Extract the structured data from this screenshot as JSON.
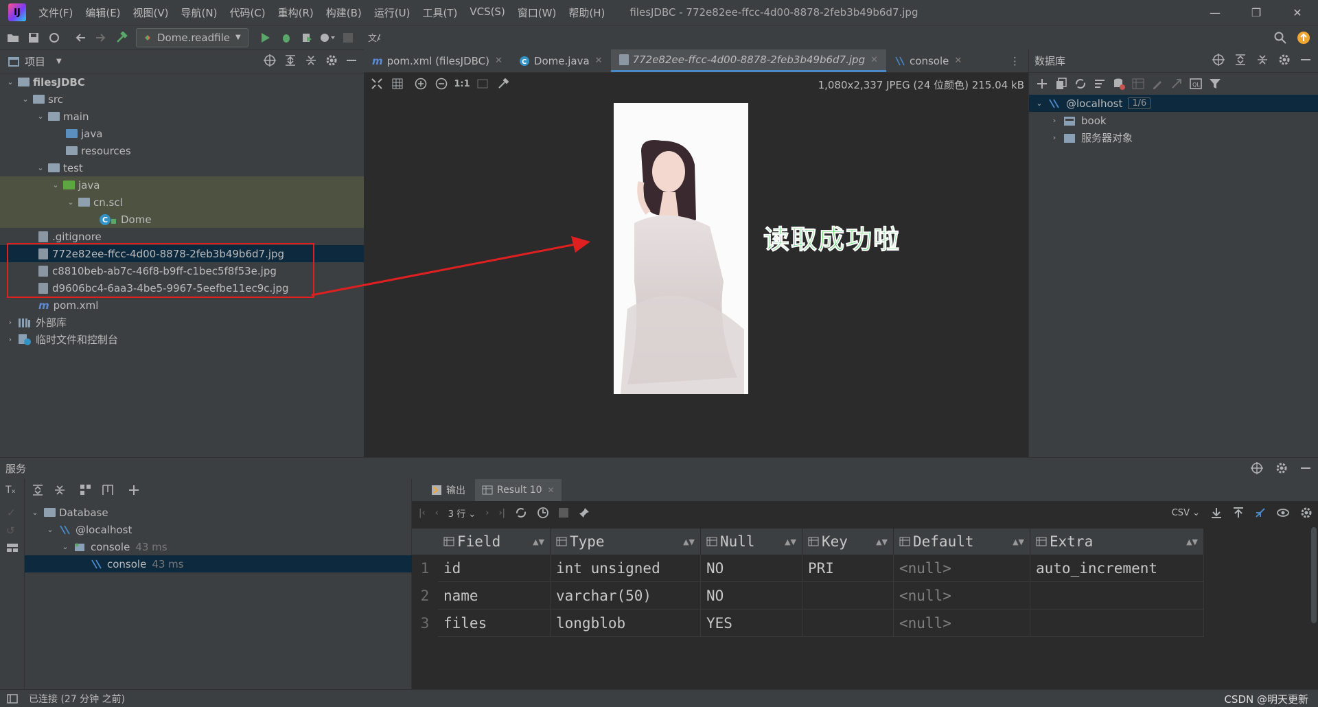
{
  "window": {
    "menu": [
      "文件(F)",
      "编辑(E)",
      "视图(V)",
      "导航(N)",
      "代码(C)",
      "重构(R)",
      "构建(B)",
      "运行(U)",
      "工具(T)",
      "VCS(S)",
      "窗口(W)",
      "帮助(H)"
    ],
    "title": "filesJDBC - 772e82ee-ffcc-4d00-8878-2feb3b49b6d7.jpg"
  },
  "toolbar": {
    "run_config": "Dome.readfile"
  },
  "project": {
    "header": "项目",
    "tree": [
      {
        "label": "filesJDBC",
        "bold": true
      },
      {
        "label": "src"
      },
      {
        "label": "main"
      },
      {
        "label": "java"
      },
      {
        "label": "resources"
      },
      {
        "label": "test"
      },
      {
        "label": "java"
      },
      {
        "label": "cn.scl"
      },
      {
        "label": "Dome"
      },
      {
        "label": ".gitignore"
      },
      {
        "label": "772e82ee-ffcc-4d00-8878-2feb3b49b6d7.jpg"
      },
      {
        "label": "c8810beb-ab7c-46f8-b9ff-c1bec5f8f53e.jpg"
      },
      {
        "label": "d9606bc4-6aa3-4be5-9967-5eefbe11ec9c.jpg"
      },
      {
        "label": "pom.xml"
      },
      {
        "label": "外部库"
      },
      {
        "label": "临时文件和控制台"
      }
    ]
  },
  "editor": {
    "tabs": [
      {
        "label": "pom.xml (filesJDBC)"
      },
      {
        "label": "Dome.java"
      },
      {
        "label": "772e82ee-ffcc-4d00-8878-2feb3b49b6d7.jpg"
      },
      {
        "label": "console"
      }
    ],
    "image_info": "1,080x2,337 JPEG (24 位颜色) 215.04 kB",
    "zoom_label": "1:1",
    "annotation": "读取成功啦"
  },
  "database": {
    "header": "数据库",
    "host": "@localhost",
    "host_badge": "1/6",
    "items": [
      "book",
      "服务器对象"
    ]
  },
  "services": {
    "header": "服务",
    "tree": [
      {
        "label": "Database",
        "time": ""
      },
      {
        "label": "@localhost",
        "time": ""
      },
      {
        "label": "console",
        "time": "43 ms"
      },
      {
        "label": "console",
        "time": "43 ms"
      }
    ],
    "tabs": [
      "输出",
      "Result 10"
    ],
    "rows_label": "3 行",
    "export_label": "CSV",
    "columns": [
      "Field",
      "Type",
      "Null",
      "Key",
      "Default",
      "Extra"
    ],
    "rows": [
      [
        "id",
        "int unsigned",
        "NO",
        "PRI",
        "<null>",
        "auto_increment"
      ],
      [
        "name",
        "varchar(50)",
        "NO",
        "",
        "<null>",
        ""
      ],
      [
        "files",
        "longblob",
        "YES",
        "",
        "<null>",
        ""
      ]
    ],
    "row_numbers": [
      "1",
      "2",
      "3"
    ]
  },
  "status": {
    "text": "已连接 (27 分钟 之前)"
  },
  "watermark": "CSDN @明天更新",
  "colors": {
    "accent": "#4a88c7",
    "selection": "#0d293e",
    "annotation_box": "#e02020",
    "annotation_text": "#2ecc40"
  }
}
